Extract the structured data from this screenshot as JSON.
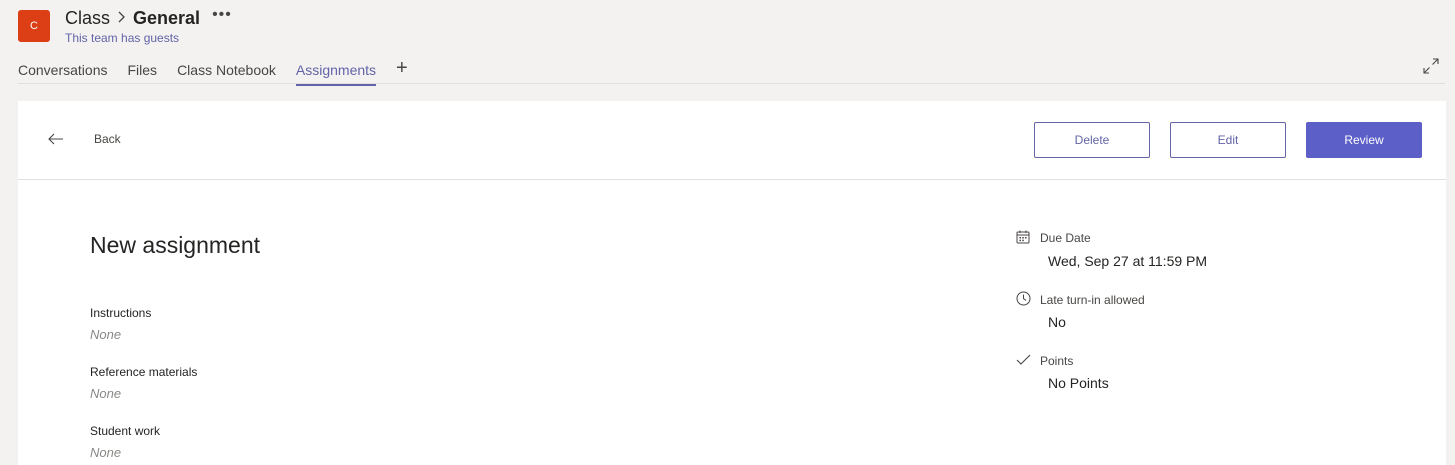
{
  "team": {
    "avatar_letter": "C",
    "avatar_color": "#dc3e16",
    "name": "Class",
    "separator": ">",
    "channel": "General",
    "more": "•••",
    "subtitle": "This team has guests"
  },
  "tabs": [
    {
      "label": "Conversations",
      "active": false
    },
    {
      "label": "Files",
      "active": false
    },
    {
      "label": "Class Notebook",
      "active": false
    },
    {
      "label": "Assignments",
      "active": true
    }
  ],
  "tab_add": "+",
  "toolbar": {
    "back_label": "Back",
    "delete_label": "Delete",
    "edit_label": "Edit",
    "review_label": "Review"
  },
  "assignment": {
    "title": "New assignment",
    "fields": [
      {
        "label": "Instructions",
        "value": "None"
      },
      {
        "label": "Reference materials",
        "value": "None"
      },
      {
        "label": "Student work",
        "value": "None"
      }
    ]
  },
  "details": {
    "due_date": {
      "icon": "calendar-icon",
      "label": "Due Date",
      "value": "Wed, Sep 27 at 11:59 PM"
    },
    "late_turn_in": {
      "icon": "clock-icon",
      "label": "Late turn-in allowed",
      "value": "No"
    },
    "points": {
      "icon": "checkmark-icon",
      "label": "Points",
      "value": "No Points"
    }
  },
  "colors": {
    "accent": "#6264a7",
    "primary_button": "#5b5fc7",
    "background": "#f3f2f1"
  }
}
